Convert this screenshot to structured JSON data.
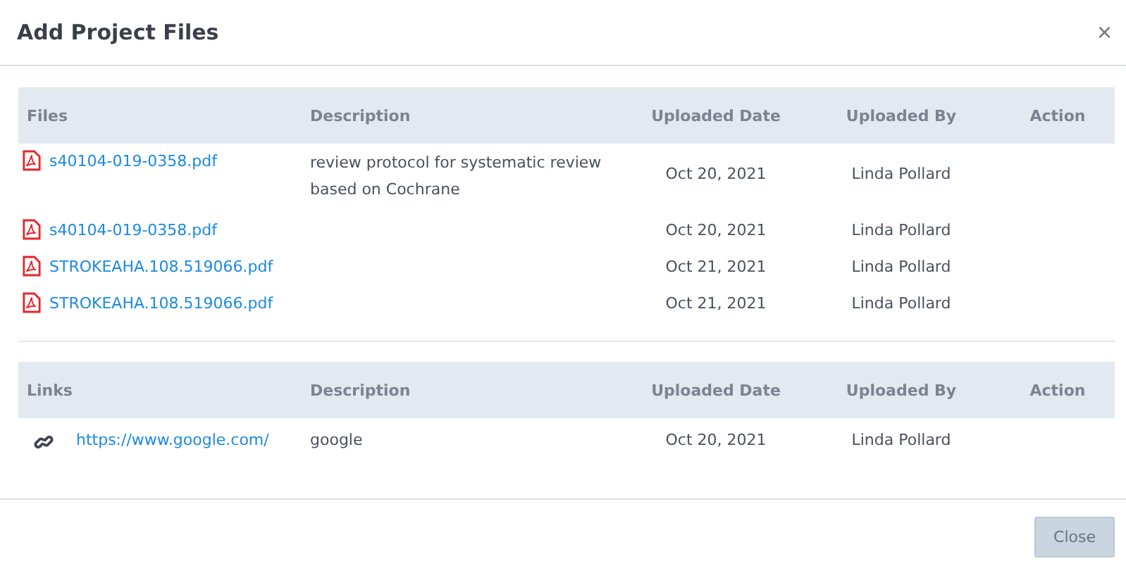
{
  "dialog": {
    "title": "Add Project Files",
    "close_symbol": "×"
  },
  "files_table": {
    "columns": [
      "Files",
      "Description",
      "Uploaded Date",
      "Uploaded By",
      "Action"
    ],
    "rows": [
      {
        "name": "s40104-019-0358.pdf",
        "description": "review protocol for systematic review based on Cochrane",
        "date": "Oct 20, 2021",
        "by": "Linda Pollard"
      },
      {
        "name": "s40104-019-0358.pdf",
        "date": "Oct 20, 2021",
        "by": "Linda Pollard"
      },
      {
        "name": "STROKEAHA.108.519066.pdf",
        "date": "Oct 21, 2021",
        "by": "Linda Pollard"
      },
      {
        "name": "STROKEAHA.108.519066.pdf",
        "date": "Oct 21, 2021",
        "by": "Linda Pollard"
      }
    ]
  },
  "links_table": {
    "columns": [
      "Links",
      "Description",
      "Uploaded Date",
      "Uploaded By",
      "Action"
    ],
    "rows": [
      {
        "url": "https://www.google.com/",
        "description": "google",
        "date": "Oct 20, 2021",
        "by": "Linda Pollard"
      }
    ]
  },
  "buttons": [
    "Close"
  ]
}
